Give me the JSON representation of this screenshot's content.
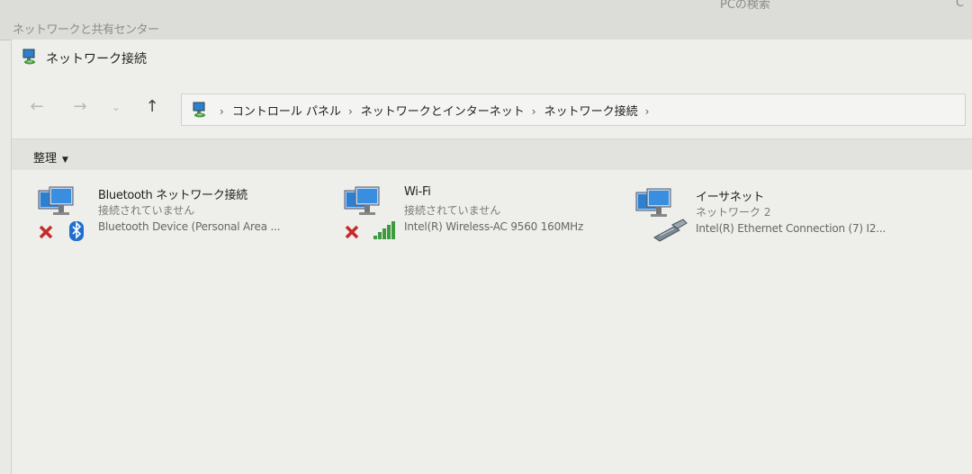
{
  "background_window": {
    "title": "ネットワークと共有センター",
    "search_fragment": "PCの検索",
    "edge_glyph": "C"
  },
  "window": {
    "title": "ネットワーク接続",
    "title_icon": "network-connections-icon"
  },
  "navigation": {
    "back_glyph": "←",
    "forward_glyph": "→",
    "dropdown_glyph": "⌄",
    "up_glyph": "↑",
    "breadcrumb_separator": "›",
    "breadcrumbs": [
      "コントロール パネル",
      "ネットワークとインターネット",
      "ネットワーク接続"
    ]
  },
  "toolbar": {
    "organize_label": "整理",
    "organize_caret": "▼"
  },
  "connections": [
    {
      "name": "Bluetooth ネットワーク接続",
      "status": "接続されていません",
      "device": "Bluetooth Device (Personal Area ...",
      "icon": "bluetooth-adapter-icon",
      "disconnected": true
    },
    {
      "name": "Wi-Fi",
      "status": "接続されていません",
      "device": "Intel(R) Wireless-AC 9560 160MHz",
      "icon": "wifi-adapter-icon",
      "disconnected": true
    },
    {
      "name": "イーサネット",
      "status": "ネットワーク 2",
      "device": "Intel(R) Ethernet Connection (7) I2...",
      "icon": "ethernet-adapter-icon",
      "disconnected": false
    }
  ],
  "colors": {
    "monitor_blue": "#2f7fd1",
    "disconnected_red": "#c42a2a",
    "wifi_green": "#3e9a3e",
    "bluetooth_blue": "#1f6fd0"
  }
}
